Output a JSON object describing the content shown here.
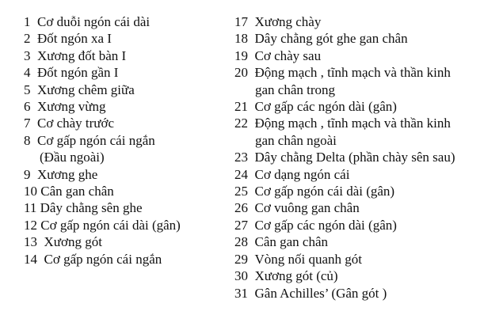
{
  "legend": {
    "left": [
      {
        "num": "1",
        "text": "Cơ duỗi ngón cái dài"
      },
      {
        "num": "2",
        "text": "Đốt ngón xa I"
      },
      {
        "num": "3",
        "text": "Xương đốt bàn I"
      },
      {
        "num": "4",
        "text": "Đốt ngón gần  I"
      },
      {
        "num": "5",
        "text": "Xương chêm giữa"
      },
      {
        "num": "6",
        "text": "Xương vừng"
      },
      {
        "num": "7",
        "text": "Cơ chày trước"
      },
      {
        "num": "8",
        "text": "Cơ gấp ngón cái ngắn",
        "cont": "(Đầu ngoài)"
      },
      {
        "num": "9",
        "text": "Xương ghe"
      },
      {
        "num": "10",
        "text": "Cân gan chân"
      },
      {
        "num": "11",
        "text": "Dây chằng sên ghe"
      },
      {
        "num": "12",
        "text": "Cơ gấp ngón cái dài (gân)"
      },
      {
        "num": "13",
        "text": "Xương gót"
      },
      {
        "num": "14",
        "text": "Cơ gấp ngón cái ngắn"
      }
    ],
    "right": [
      {
        "num": "17",
        "text": "Xương chày"
      },
      {
        "num": "18",
        "text": "Dây chằng gót ghe gan chân"
      },
      {
        "num": "19",
        "text": "Cơ chày sau"
      },
      {
        "num": "20",
        "text": "Động mạch , tĩnh mạch và thần kinh",
        "cont": "gan chân trong"
      },
      {
        "num": "21",
        "text": "Cơ gấp các ngón dài (gân)"
      },
      {
        "num": "22",
        "text": "Động mạch , tĩnh mạch và thần kinh",
        "cont": "gan chân ngoài"
      },
      {
        "num": "23",
        "text": "Dây chằng Delta (phần chày sên sau)"
      },
      {
        "num": "24",
        "text": "Cơ dạng ngón cái"
      },
      {
        "num": "25",
        "text": "Cơ gấp ngón cái dài (gân)"
      },
      {
        "num": "26",
        "text": "Cơ vuông gan chân"
      },
      {
        "num": "27",
        "text": "Cơ gấp các ngón dài (gân)"
      },
      {
        "num": "28",
        "text": "Cân gan chân"
      },
      {
        "num": "29",
        "text": "Vòng nối quanh gót"
      },
      {
        "num": "30",
        "text": "Xương gót (củ)"
      },
      {
        "num": "31",
        "text": "Gân Achilles’ (Gân gót )"
      }
    ]
  }
}
